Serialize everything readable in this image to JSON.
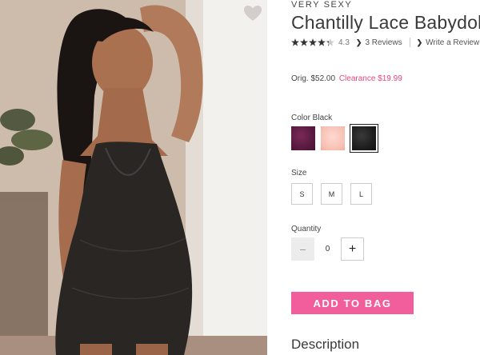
{
  "product": {
    "brand": "VERY SEXY",
    "title": "Chantilly Lace Babydoll",
    "image_alt": "Model wearing black lace babydoll"
  },
  "rating": {
    "value": 4.3,
    "value_text": "4.3",
    "stars_filled": 4,
    "reviews_link": "3 Reviews",
    "write_link": "Write a Review"
  },
  "pricing": {
    "original": "Orig. $52.00",
    "clearance": "Clearance $19.99",
    "clearance_color": "#e8467a"
  },
  "color": {
    "label": "Color Black",
    "options": [
      {
        "name": "purple",
        "hex": "#5a1a40"
      },
      {
        "name": "pink",
        "hex": "#f7c0b3"
      },
      {
        "name": "black",
        "hex": "#1e1e1e",
        "selected": true
      }
    ]
  },
  "size": {
    "label": "Size",
    "options": [
      "S",
      "M",
      "L"
    ]
  },
  "quantity": {
    "label": "Quantity",
    "value": "0",
    "minus_icon": "minus-icon",
    "plus_icon": "plus-icon"
  },
  "cta": {
    "label": "ADD TO BAG",
    "color": "#f25e9b"
  },
  "description": {
    "heading": "Description"
  },
  "icons": {
    "favorite": "heart-icon",
    "chevron": "chevron-right-icon",
    "star": "star-icon"
  }
}
